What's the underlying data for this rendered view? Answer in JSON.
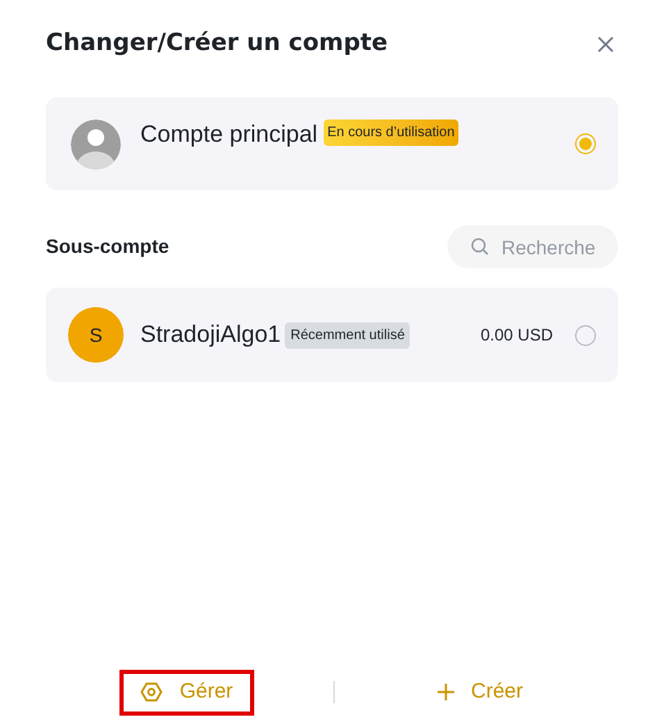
{
  "dialog": {
    "title": "Changer/Créer un compte"
  },
  "main_account": {
    "name": "Compte principal",
    "badge": "En cours d’utilisation",
    "selected": true
  },
  "sub_accounts": {
    "heading": "Sous-compte",
    "search": {
      "placeholder": "Recherche"
    },
    "items": [
      {
        "initial": "S",
        "name": "StradojiAlgo1",
        "badge": "Récemment utilisé",
        "balance": "0.00 USD",
        "selected": false
      }
    ]
  },
  "footer": {
    "manage": {
      "label": "Gérer",
      "highlighted": true
    },
    "create": {
      "label": "Créer"
    }
  }
}
